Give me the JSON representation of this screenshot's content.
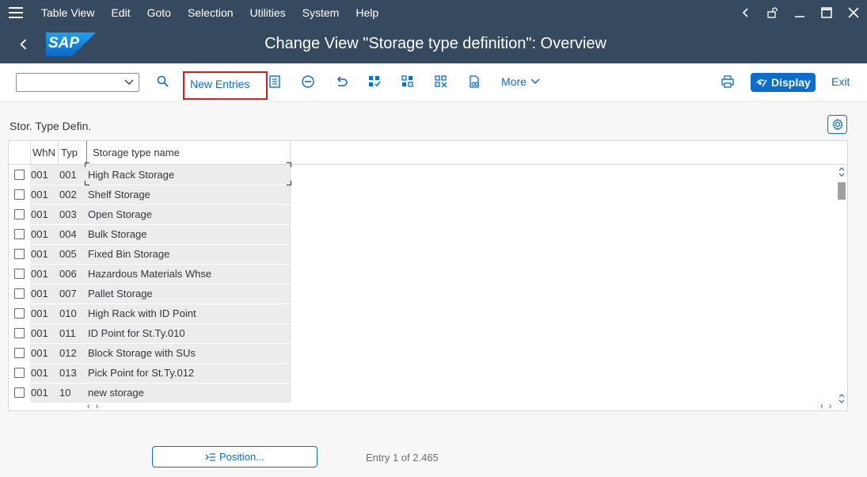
{
  "menu": {
    "items": [
      "Table View",
      "Edit",
      "Goto",
      "Selection",
      "Utilities",
      "System",
      "Help"
    ]
  },
  "title": {
    "logo_text": "SAP",
    "page_title": "Change View \"Storage type definition\": Overview"
  },
  "toolbar": {
    "command_field_value": "",
    "new_entries_label": "New Entries",
    "more_label": "More",
    "display_label": "Display",
    "exit_label": "Exit",
    "icons": [
      "search-icon",
      "details-icon",
      "delete-icon",
      "undo-icon",
      "select-all-icon",
      "select-block-icon",
      "deselect-all-icon",
      "copy-as-icon",
      "print-icon"
    ]
  },
  "section": {
    "title": "Stor. Type Defin."
  },
  "table": {
    "columns": [
      "WhN",
      "Typ",
      "Storage type name"
    ],
    "rows": [
      {
        "whn": "001",
        "typ": "001",
        "name": "High Rack Storage"
      },
      {
        "whn": "001",
        "typ": "002",
        "name": "Shelf Storage"
      },
      {
        "whn": "001",
        "typ": "003",
        "name": "Open Storage"
      },
      {
        "whn": "001",
        "typ": "004",
        "name": "Bulk Storage"
      },
      {
        "whn": "001",
        "typ": "005",
        "name": "Fixed Bin Storage"
      },
      {
        "whn": "001",
        "typ": "006",
        "name": "Hazardous Materials Whse"
      },
      {
        "whn": "001",
        "typ": "007",
        "name": "Pallet Storage"
      },
      {
        "whn": "001",
        "typ": "010",
        "name": "High Rack with ID Point"
      },
      {
        "whn": "001",
        "typ": "011",
        "name": "ID Point for St.Ty.010"
      },
      {
        "whn": "001",
        "typ": "012",
        "name": "Block Storage with SUs"
      },
      {
        "whn": "001",
        "typ": "013",
        "name": "Pick Point for St.Ty.012"
      },
      {
        "whn": "001",
        "typ": "10",
        "name": "new storage"
      }
    ]
  },
  "footer": {
    "position_label": "Position...",
    "entry_info": "Entry 1 of 2.465"
  },
  "colors": {
    "shell": "#354a5f",
    "accent": "#0a6ed1",
    "highlight_border": "#e01a1a"
  }
}
